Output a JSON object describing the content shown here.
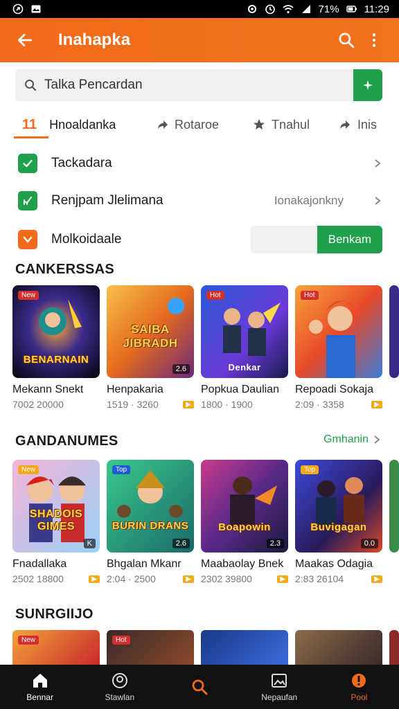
{
  "status": {
    "battery": "71%",
    "time": "11:29"
  },
  "app_bar": {
    "title": "Inahapka"
  },
  "search": {
    "placeholder": "Talka Pencardan"
  },
  "tabs": [
    {
      "count": "11",
      "label": "Hnoaldanka"
    },
    {
      "label": "Rotaroe"
    },
    {
      "label": "Tnahul"
    },
    {
      "label": "Inis"
    }
  ],
  "options": [
    {
      "label": "Tackadara"
    },
    {
      "label": "Renjpam Jlelimana",
      "value": "Ionakajonkny"
    },
    {
      "label": "Molkoidaale",
      "button": "Benkam"
    }
  ],
  "sections": [
    {
      "title": "CANKERSSAS",
      "cards": [
        {
          "title": "Mekann Snekt",
          "meta": "7002 20000",
          "badge": "New",
          "art": "BENARNAIN"
        },
        {
          "title": "Henpakaria",
          "meta": "1519 · 3260",
          "corner": "2.6",
          "art": "SAIBA JIBRADH"
        },
        {
          "title": "Popkua Daulian",
          "meta": "1800 · 1900",
          "badge": "Hot",
          "art": "Denkar"
        },
        {
          "title": "Repoadi Sokaja",
          "meta": "2:09 · 3358",
          "badge": "Hot",
          "art": ""
        }
      ]
    },
    {
      "title": "GANDANUMES",
      "link": "Gmhanin",
      "cards": [
        {
          "title": "Fnadallaka",
          "meta": "2502 18800",
          "badge": "New",
          "corner": "K",
          "art": "SHADOIS GIMES"
        },
        {
          "title": "Bhgalan Mkanr",
          "meta": "2:04 · 2500",
          "badge": "Top",
          "corner": "2.6",
          "art": "BURIN DRANS"
        },
        {
          "title": "Maabaolay Bnek",
          "meta": "2302 39800",
          "corner": "2.3",
          "art": "Boapowin"
        },
        {
          "title": "Maakas Odagia",
          "meta": "2:83 26104",
          "badge": "Top",
          "corner": "0.0",
          "art": "Buvigagan"
        }
      ]
    },
    {
      "title": "SUNRGIIJO",
      "cards": [
        {
          "badge": "New"
        },
        {
          "badge": "Hot"
        },
        {},
        {}
      ]
    }
  ],
  "bottom_nav": [
    {
      "label": "Bennar",
      "icon": "home-icon"
    },
    {
      "label": "Stawlan",
      "icon": "profile-icon"
    },
    {
      "label": "",
      "icon": "search-icon"
    },
    {
      "label": "Nepaufan",
      "icon": "gallery-icon"
    },
    {
      "label": "Pool",
      "icon": "alert-icon"
    }
  ],
  "colors": {
    "accent": "#f26a1b",
    "success": "#1fa04a",
    "nav_bg": "#111111"
  }
}
